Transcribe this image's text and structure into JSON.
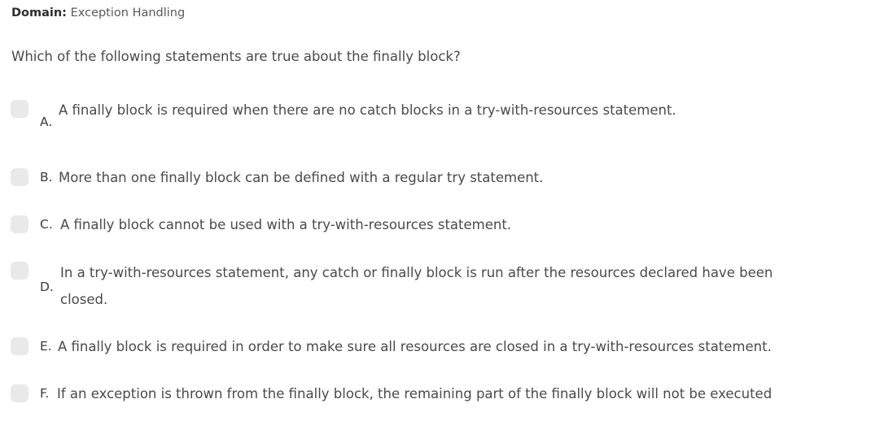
{
  "domain": {
    "label": "Domain:",
    "value": "Exception Handling"
  },
  "question": {
    "text": "Which of the following statements are true about the finally block?"
  },
  "options": [
    {
      "letter": "A.",
      "lines": [
        "A finally block is required when there are no catch blocks in a try-with-resources statement."
      ]
    },
    {
      "letter": "B.",
      "lines": [
        "More than one finally block can be defined with a regular try statement."
      ]
    },
    {
      "letter": "C.",
      "lines": [
        "A finally block cannot be used with a try-with-resources statement."
      ]
    },
    {
      "letter": "D.",
      "lines": [
        "In a try-with-resources statement, any catch or finally block is run after the resources declared have been",
        "closed."
      ]
    },
    {
      "letter": "E.",
      "lines": [
        "A finally block is required in order to make sure all resources are closed in a try-with-resources statement."
      ]
    },
    {
      "letter": "F.",
      "lines": [
        "If an exception is thrown from the finally block, the remaining part of the finally block will not be executed"
      ]
    }
  ]
}
